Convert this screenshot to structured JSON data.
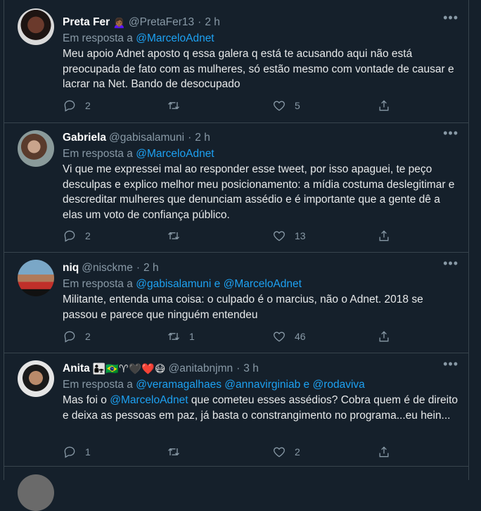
{
  "tweets": [
    {
      "name": "Preta Fer",
      "name_emoji": "🙍🏾‍♀️",
      "handle": "@PretaFer13",
      "time": "2 h",
      "reply_prefix": "Em resposta a",
      "reply_to": "@MarceloAdnet",
      "text": "Meu apoio Adnet aposto q essa galera q está te acusando aqui não está preocupada de fato com as mulheres, só estão mesmo com vontade de causar e lacrar na Net. Bando de desocupado",
      "replies": "2",
      "retweets": "",
      "likes": "5"
    },
    {
      "name": "Gabriela",
      "handle": "@gabisalamuni",
      "time": "2 h",
      "reply_prefix": "Em resposta a",
      "reply_to": "@MarceloAdnet",
      "text": "Vi que me expressei mal ao responder esse tweet, por isso apaguei, te peço desculpas e explico melhor meu posicionamento: a mídia costuma deslegitimar e descreditar mulheres que denunciam assédio e é importante que a gente dê a elas um voto de confiança público.",
      "replies": "2",
      "retweets": "",
      "likes": "13"
    },
    {
      "name": "niq",
      "handle": "@nisckme",
      "time": "2 h",
      "reply_prefix": "Em resposta a",
      "reply_to_1": "@gabisalamuni",
      "reply_and": "e",
      "reply_to_2": "@MarceloAdnet",
      "text": "Militante, entenda uma coisa: o culpado é o marcius, não o Adnet. 2018 se passou e parece que ninguém entendeu",
      "replies": "2",
      "retweets": "1",
      "likes": "46"
    },
    {
      "name": "Anita",
      "name_emojis": "👨‍👧🇧🇷♈🖤❤️😷",
      "handle": "@anitabnjmn",
      "time": "3 h",
      "reply_prefix": "Em resposta a",
      "reply_to_1": "@veramagalhaes",
      "reply_to_2": "@annavirginiab",
      "reply_and": "e",
      "reply_to_3": "@rodaviva",
      "text_pre": "Mas foi o",
      "text_mention": "@MarceloAdnet",
      "text_post": "que cometeu esses assédios? Cobra quem é de direito e deixa as pessoas em paz, já basta o constrangimento no programa...eu hein...",
      "replies": "1",
      "retweets": "",
      "likes": "2"
    }
  ],
  "icons": {
    "reply": "reply-icon",
    "retweet": "retweet-icon",
    "like": "heart-icon",
    "share": "share-icon",
    "more": "more-icon"
  },
  "colors": {
    "background": "#15202b",
    "link": "#1da1f2",
    "muted": "#8899a6",
    "divider": "#38444d"
  }
}
